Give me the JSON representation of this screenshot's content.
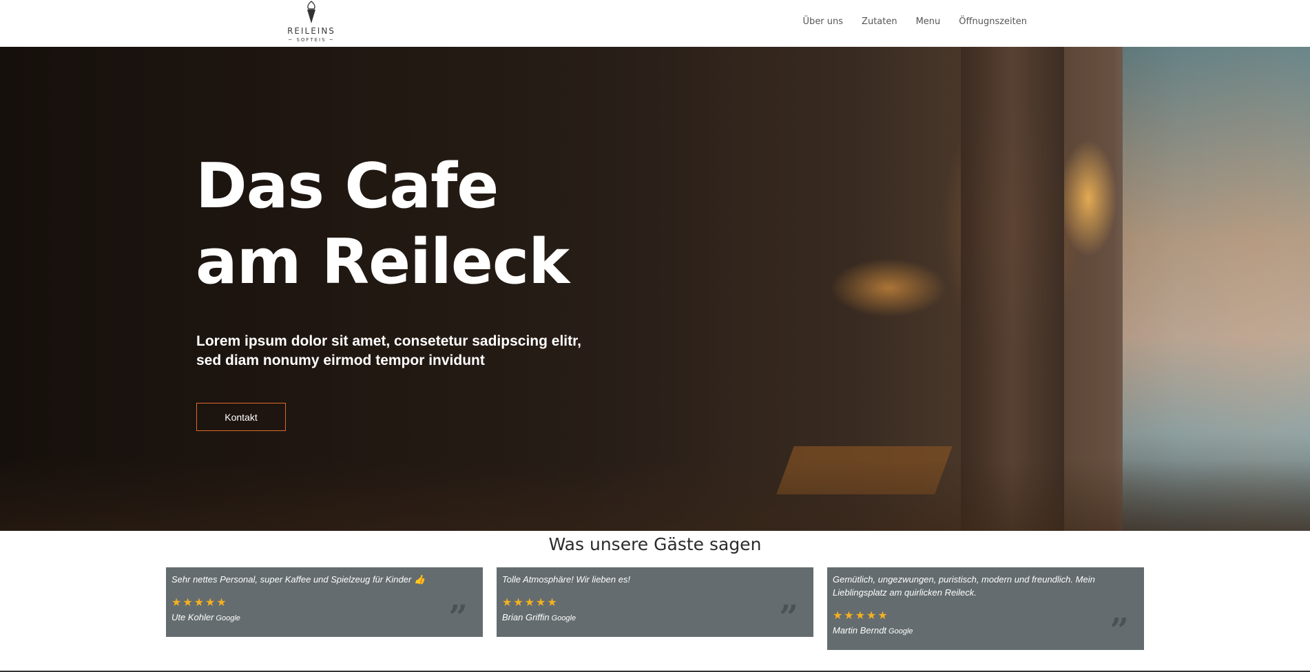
{
  "brand": {
    "name": "REILEINS",
    "sub": "~ SOFTEIS ~"
  },
  "nav": {
    "items": [
      {
        "label": "Über uns"
      },
      {
        "label": "Zutaten"
      },
      {
        "label": "Menu"
      },
      {
        "label": "Öffnugnszeiten"
      }
    ]
  },
  "hero": {
    "title_line1": "Das Cafe",
    "title_line2": "am Reileck",
    "subtitle_line1": "Lorem ipsum dolor sit amet, consetetur sadipscing elitr,",
    "subtitle_line2": "sed diam nonumy eirmod tempor invidunt",
    "button_label": "Kontakt",
    "accent_color": "#e06a2c"
  },
  "testimonials": {
    "title": "Was unsere Gäste sagen",
    "card_color": "#646c6f",
    "star_color": "#f4b120",
    "items": [
      {
        "text": "Sehr nettes Personal, super Kaffee und Spielzeug für Kinder 👍",
        "stars": "★★★★★",
        "author": "Ute Kohler",
        "source": "Google"
      },
      {
        "text": "Tolle Atmosphäre! Wir lieben es!",
        "stars": "★★★★★",
        "author": "Brian Griffin",
        "source": "Google"
      },
      {
        "text": "Gemütlich, ungezwungen, puristisch, modern und freundlich. Mein Lieblingsplatz am quirlicken Reileck.",
        "stars": "★★★★★",
        "author": "Martin Berndt",
        "source": "Google"
      }
    ],
    "quote_icon": "quote-icon"
  }
}
